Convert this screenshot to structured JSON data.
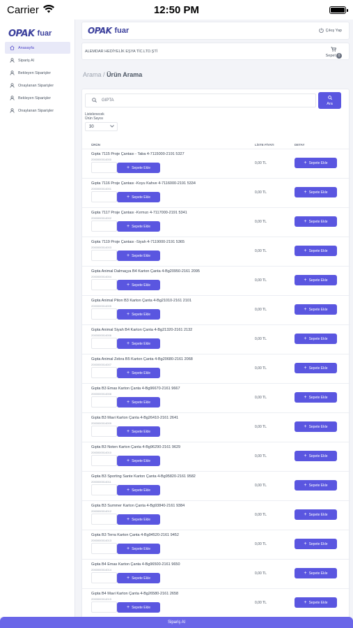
{
  "status_bar": {
    "carrier": "Carrier",
    "time": "12:50 PM",
    "battery_level": 1.0
  },
  "brand": {
    "logo_text": "OPAK",
    "logo_sub": "fuar"
  },
  "sidebar": {
    "items": [
      {
        "label": "Anasayfa",
        "icon": "home-icon",
        "active": true
      },
      {
        "label": "Sipariş Al",
        "icon": "user-icon"
      },
      {
        "label": "Bekleyen Siparişler",
        "icon": "user-icon"
      },
      {
        "label": "Onaylanan Siparişler",
        "icon": "user-icon"
      },
      {
        "label": "Bekleyen Siparişler",
        "icon": "user-icon"
      },
      {
        "label": "Onaylanan Siparişler",
        "icon": "user-icon"
      }
    ]
  },
  "header": {
    "logout_label": "Çıkış Yap"
  },
  "company_bar": {
    "company_name": "ALEMDAR HEDİYELİK EŞYA TİC.LTD.ŞTİ",
    "cart_label": "Sepet",
    "cart_count": "0"
  },
  "breadcrumb": {
    "parent": "Arama",
    "separator": "/",
    "current": "Ürün Arama"
  },
  "search": {
    "value": "GIPTA",
    "button_label": "Ara"
  },
  "list_count": {
    "label_line1": "Listelenecek",
    "label_line2": "Ürün Sayısı",
    "value": "30"
  },
  "table": {
    "headers": {
      "product": "ÜRÜN",
      "price": "LİSTE FİYATI",
      "detail": "DETAY"
    },
    "add_label": "Sepete Ekle",
    "rows": [
      {
        "name": "Gıpta 7115 Proje Çantası - Taba 4-7115000-2191 5327",
        "code": "2000000014000",
        "price": "0,00 TL"
      },
      {
        "name": "Gıpta 7116 Proje Çantası -Koyu Kahve 4-7116000-2191 5334",
        "code": "2000000014001",
        "price": "0,00 TL"
      },
      {
        "name": "Gıpta 7117 Proje Çantası -Kırmızı 4-7117000-2191 5341",
        "code": "2000000014002",
        "price": "0,00 TL"
      },
      {
        "name": "Gıpta 7119 Proje Çantası -Siyah 4-7119000-2191 5365",
        "code": "2000000014003",
        "price": "0,00 TL"
      },
      {
        "name": "Gıpta Animal Dalmaçya B4 Karton Çanta 4-Bg20950-2161 2095",
        "code": "2000000014004",
        "price": "0,00 TL"
      },
      {
        "name": "Gıpta Animal Piton B3 Karton Çanta 4-Bg21010-2161 2101",
        "code": "2000000014005",
        "price": "0,00 TL"
      },
      {
        "name": "Gıpta Animal Siyah B4 Karton Çanta 4-Bg21320-2161 2132",
        "code": "2000000014006",
        "price": "0,00 TL"
      },
      {
        "name": "Gıpta Animal Zebra B5 Karton Çanta 4-Bg20680-2161 2068",
        "code": "2000000014007",
        "price": "0,00 TL"
      },
      {
        "name": "Gıpta B3 Emas Karton Çanta 4-Bg96670-2161 9667",
        "code": "2000000014008",
        "price": "0,00 TL"
      },
      {
        "name": "Gıpta B3 Mavi Karton Çanta 4-Bg26410-2161 2641",
        "code": "2000000014009",
        "price": "0,00 TL"
      },
      {
        "name": "Gıpta B3 Noten Karton Çanta 4-Bg96290-2161 9629",
        "code": "2000000014010",
        "price": "0,00 TL"
      },
      {
        "name": "Gıpta B3 Sporting Sante Karton Çanta 4-Bg95820-2161 9582",
        "code": "2000000014011",
        "price": "0,00 TL"
      },
      {
        "name": "Gıpta B3 Summer Karton Çanta 4-Bg93840-2161 9384",
        "code": "2000000014012",
        "price": "0,00 TL"
      },
      {
        "name": "Gıpta B3 Terra Karton Çanta 4-Bg94520-2161 9452",
        "code": "2000000014013",
        "price": "0,00 TL"
      },
      {
        "name": "Gıpta B4 Emas Karton Çanta 4-Bg96500-2161 9650",
        "code": "2000000014014",
        "price": "0,00 TL"
      },
      {
        "name": "Gıpta B4 Mavi Karton Çanta 4-Bg26580-2161 2658",
        "code": "2000000014015",
        "price": "0,00 TL"
      }
    ]
  },
  "bottom_bar": {
    "label": "Sipariş Al"
  },
  "colors": {
    "accent": "#5a56e0",
    "brand": "#3b3f9c"
  }
}
